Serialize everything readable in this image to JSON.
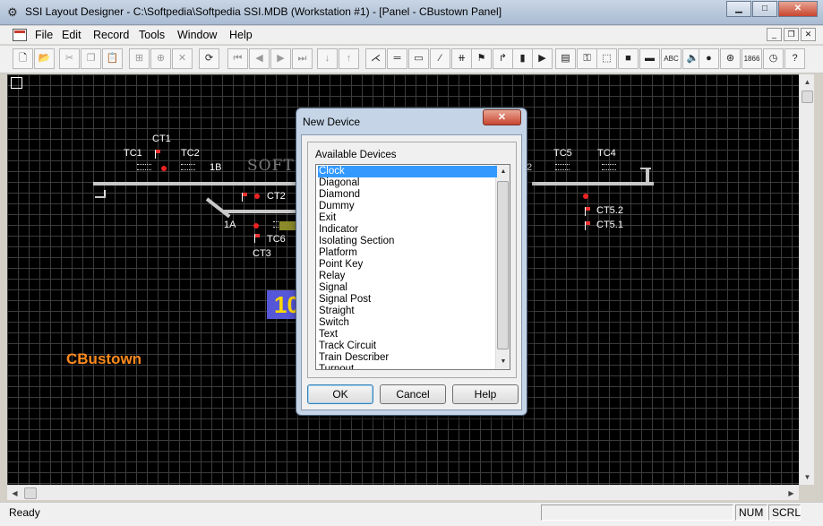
{
  "window": {
    "title": "SSI Layout Designer - C:\\Softpedia\\Softpedia SSI.MDB (Workstation #1) - [Panel - CBustown Panel]",
    "minimize": "▁",
    "maximize": "□",
    "close": "✕"
  },
  "menubar": {
    "items": [
      "File",
      "Edit",
      "Record",
      "Tools",
      "Window",
      "Help"
    ],
    "mdi_minimize": "_",
    "mdi_restore": "❐",
    "mdi_close": "✕"
  },
  "toolbar": {
    "buttons": [
      {
        "icon": "new-file-icon",
        "glyph": "🗋"
      },
      {
        "icon": "open-folder-icon",
        "glyph": "📂"
      },
      {
        "icon": "cut-icon",
        "glyph": "✂"
      },
      {
        "icon": "copy-icon",
        "glyph": "❐"
      },
      {
        "icon": "paste-icon",
        "glyph": "📋"
      },
      {
        "icon": "add-record-icon",
        "glyph": "⊞"
      },
      {
        "icon": "insert-record-icon",
        "glyph": "⊕"
      },
      {
        "icon": "delete-record-icon",
        "glyph": "✕"
      },
      {
        "icon": "refresh-icon",
        "glyph": "⟳"
      },
      {
        "icon": "first-record-icon",
        "glyph": "⏮"
      },
      {
        "icon": "previous-record-icon",
        "glyph": "◀"
      },
      {
        "icon": "next-record-icon",
        "glyph": "▶"
      },
      {
        "icon": "last-record-icon",
        "glyph": "⏭"
      },
      {
        "icon": "sort-ascending-icon",
        "glyph": "↓"
      },
      {
        "icon": "sort-descending-icon",
        "glyph": "↑"
      },
      {
        "icon": "turnout-icon",
        "glyph": "⋌"
      },
      {
        "icon": "straight-icon",
        "glyph": "═"
      },
      {
        "icon": "platform-icon",
        "glyph": "▭"
      },
      {
        "icon": "diagonal-icon",
        "glyph": "⁄"
      },
      {
        "icon": "diamond-icon",
        "glyph": "⧺"
      },
      {
        "icon": "signal-icon",
        "glyph": "⚑"
      },
      {
        "icon": "signal-post-icon",
        "glyph": "↱"
      },
      {
        "icon": "indicator-icon",
        "glyph": "▮"
      },
      {
        "icon": "route-icon",
        "glyph": "▶"
      },
      {
        "icon": "track-circuit-icon",
        "glyph": "▤"
      },
      {
        "icon": "point-key-icon",
        "glyph": "⚿"
      },
      {
        "icon": "isolating-section-icon",
        "glyph": "⬚"
      },
      {
        "icon": "grey-block-icon",
        "glyph": "■"
      },
      {
        "icon": "train-describer-icon",
        "glyph": "▬"
      },
      {
        "icon": "text-icon",
        "glyph": "ABC"
      },
      {
        "icon": "speaker-icon",
        "glyph": "🔈"
      },
      {
        "icon": "lamp-icon",
        "glyph": "●"
      },
      {
        "icon": "relay-icon",
        "glyph": "⊛"
      },
      {
        "icon": "counter-icon",
        "glyph": "1866"
      },
      {
        "icon": "clock-icon",
        "glyph": "◷"
      },
      {
        "icon": "help-icon",
        "glyph": "?"
      }
    ]
  },
  "canvas": {
    "labels": {
      "ct1": "CT1",
      "tc1": "TC1",
      "tc2": "TC2",
      "b1": "1B",
      "ct2": "CT2",
      "a1": "1A",
      "tc6": "TC6",
      "ct3": "CT3",
      "two": "2",
      "tc5": "TC5",
      "tc4": "TC4",
      "ct52": "CT5.2",
      "ct51": "CT5.1"
    },
    "train_describer": "10",
    "panel_name": "CBustown",
    "watermark": "SOFTPEDIA",
    "colors": {
      "background": "#000000",
      "grid": "#3c3c3c",
      "track": "#c8c8c8",
      "signal": "#e22222",
      "panel_name": "#ff8a1c",
      "describer_bg": "#5656d8",
      "describer_text": "#ffd800"
    }
  },
  "dialog": {
    "title": "New Device",
    "close": "✕",
    "group_label": "Available Devices",
    "devices": [
      "Clock",
      "Diagonal",
      "Diamond",
      "Dummy",
      "Exit",
      "Indicator",
      "Isolating Section",
      "Platform",
      "Point Key",
      "Relay",
      "Signal",
      "Signal Post",
      "Straight",
      "Switch",
      "Text",
      "Track Circuit",
      "Train Describer",
      "Turnout"
    ],
    "selected": "Clock",
    "ok": "OK",
    "cancel": "Cancel",
    "help": "Help"
  },
  "statusbar": {
    "text": "Ready",
    "num": "NUM",
    "scrl": "SCRL"
  }
}
